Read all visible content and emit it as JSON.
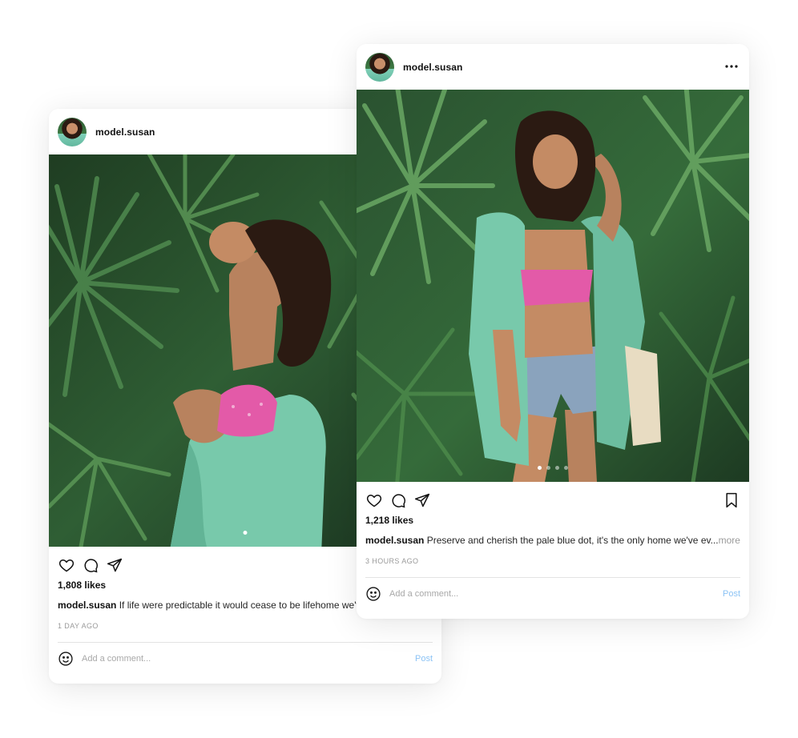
{
  "posts": [
    {
      "username": "model.susan",
      "likes": "1,808 likes",
      "caption_user": "model.susan",
      "caption_text": "If life were predictable it would cease to be lifehome we've ev...",
      "caption_more": "",
      "time": "1 DAY AGO",
      "comment_placeholder": "Add a comment...",
      "post_label": "Post",
      "carousel_dots": 1,
      "active_dot": 1
    },
    {
      "username": "model.susan",
      "likes": "1,218 likes",
      "caption_user": "model.susan",
      "caption_text": "Preserve and cherish the pale blue dot, it's the only home we've ev...",
      "caption_more": "more",
      "time": "3 HOURS AGO",
      "comment_placeholder": "Add a comment...",
      "post_label": "Post",
      "carousel_dots": 4,
      "active_dot": 1
    }
  ],
  "icons": {
    "like": "heart-icon",
    "comment": "comment-icon",
    "share": "paper-plane-icon",
    "save": "bookmark-icon",
    "emoji": "smiley-icon",
    "menu": "more-dots-icon"
  },
  "colors": {
    "post_button": "#8cc3f5",
    "muted_text": "#9a9a9a",
    "foliage": "#2f5e34",
    "shirt": "#78c9ab",
    "top": "#e35aa8"
  }
}
